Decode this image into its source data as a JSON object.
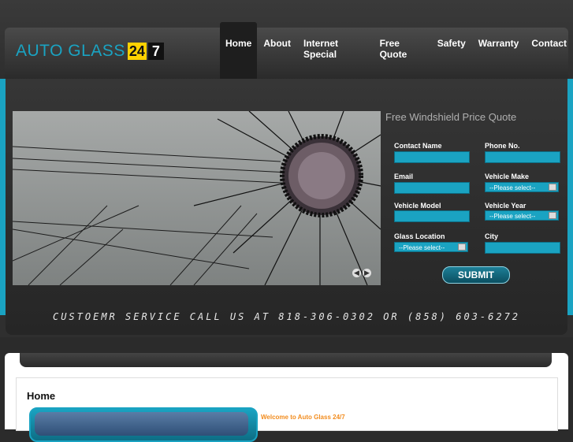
{
  "logo": {
    "text": "AUTO GLASS",
    "num1": "24",
    "num2": "7"
  },
  "nav": {
    "items": [
      {
        "label": "Home"
      },
      {
        "label": "About"
      },
      {
        "label": "Internet Special"
      },
      {
        "label": "Free Quote"
      },
      {
        "label": "Safety"
      },
      {
        "label": "Warranty"
      },
      {
        "label": "Contact"
      }
    ]
  },
  "slider": {
    "prev": "◀",
    "next": "▶"
  },
  "form": {
    "title": "Free Windshield Price Quote",
    "contact_name": "Contact Name",
    "phone": "Phone No.",
    "email": "Email",
    "vehicle_make": "Vehicle Make",
    "vehicle_model": "Vehicle Model",
    "vehicle_year": "Vehicle Year",
    "glass_location": "Glass Location",
    "city": "City",
    "make_select": "--Please select--",
    "year_select": "--Please select--",
    "glass_select": "--Please select--",
    "submit": "SUBMIT"
  },
  "service_line": "CUSTOEMR SERVICE CALL US AT 818-306-0302 OR (858) 603-6272",
  "content": {
    "heading": "Home",
    "welcome": "Welcome to Auto Glass 24/7"
  },
  "colors": {
    "accent": "#1aa3c2",
    "logo_yellow": "#ffd200",
    "welcome_orange": "#f28c1e"
  }
}
